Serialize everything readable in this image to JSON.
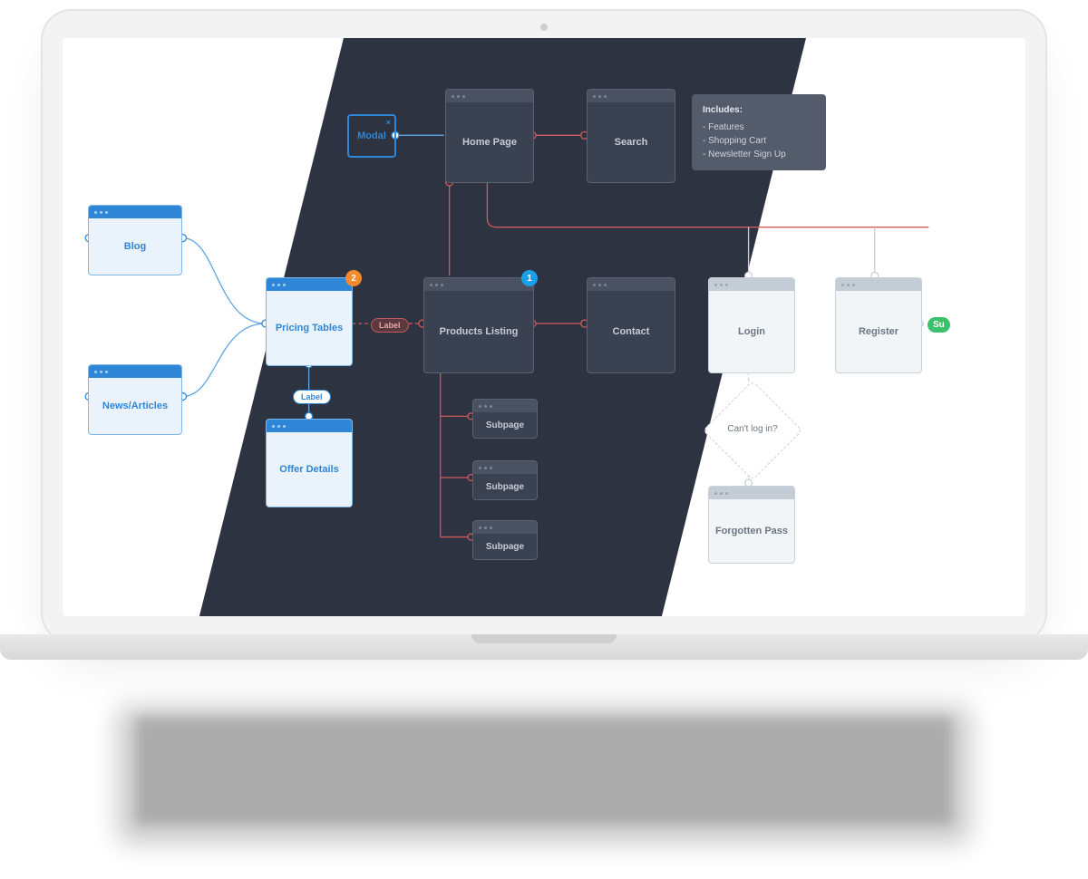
{
  "modal": {
    "label": "Modal"
  },
  "light_cards": {
    "blog": "Blog",
    "news": "News/Articles",
    "pricing": "Pricing Tables",
    "offer": "Offer Details"
  },
  "dark_cards": {
    "home": "Home Page",
    "search": "Search",
    "products": "Products Listing",
    "contact": "Contact",
    "sub1": "Subpage",
    "sub2": "Subpage",
    "sub3": "Subpage"
  },
  "grey_cards": {
    "login": "Login",
    "register": "Register",
    "forgotten": "Forgotten Pass"
  },
  "note": {
    "title": "Includes:",
    "items": [
      "- Features",
      "- Shopping Cart",
      "- Newsletter Sign Up"
    ]
  },
  "labels": {
    "pill_blue": "Label",
    "pill_red": "Label",
    "pill_green": "Su"
  },
  "badges": {
    "orange": "2",
    "blue": "1"
  },
  "decision": {
    "label": "Can't log in?"
  }
}
